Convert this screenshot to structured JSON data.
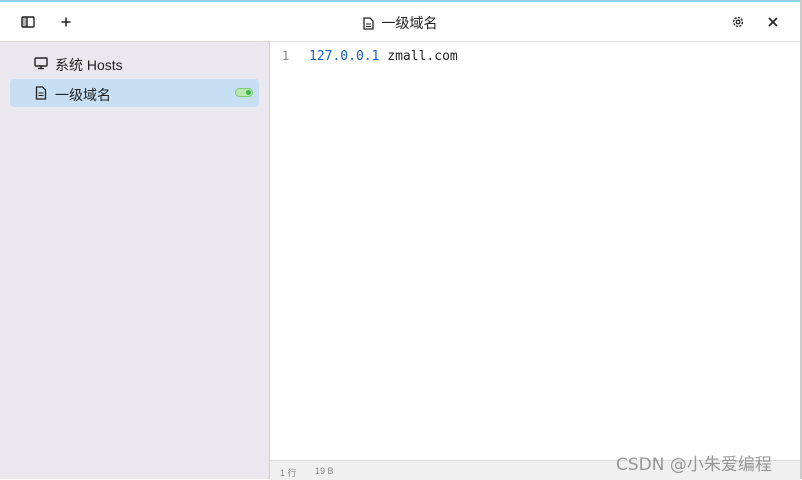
{
  "window": {
    "title": "一级域名"
  },
  "sidebar": {
    "items": [
      {
        "label": "系统 Hosts",
        "icon": "monitor-icon",
        "active": false
      },
      {
        "label": "一级域名",
        "icon": "document-icon",
        "active": true,
        "enabled": true
      }
    ]
  },
  "editor": {
    "line_number": "1",
    "ip": "127.0.0.1",
    "host": " zmall.com"
  },
  "status": {
    "lines": "1 行",
    "bytes": "19 B"
  },
  "watermark": "CSDN @小朱爱编程",
  "colors": {
    "active_item": "#c6dff3",
    "sidebar_bg": "#ebe7ee",
    "ip_text": "#1a5fc4"
  }
}
